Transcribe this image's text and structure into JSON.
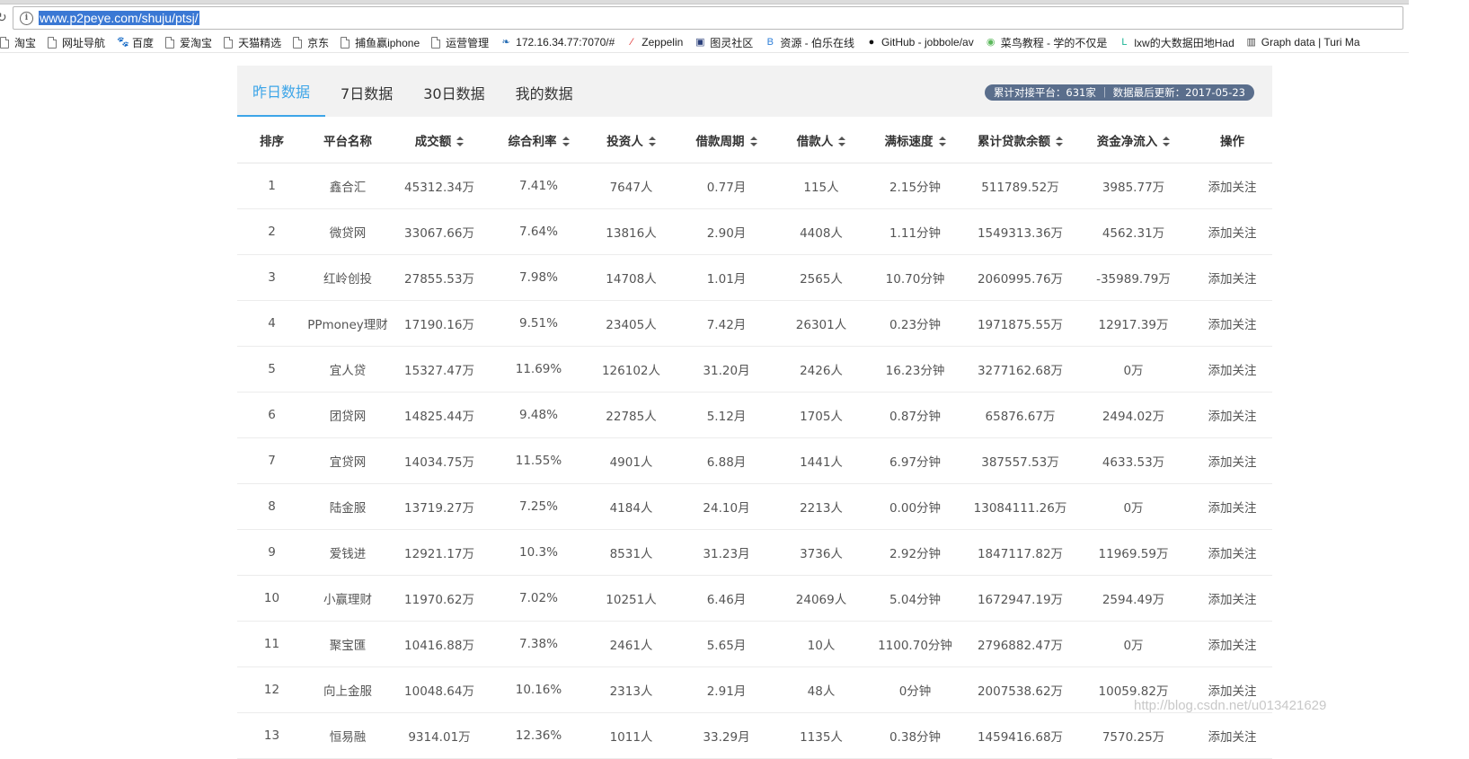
{
  "browser": {
    "url": "www.p2peye.com/shuju/ptsj/",
    "bookmarks": [
      {
        "label": "淘宝",
        "icon": "page-icon"
      },
      {
        "label": "网址导航",
        "icon": "page-icon"
      },
      {
        "label": "百度",
        "icon": "baidu-paw-icon"
      },
      {
        "label": "爱淘宝",
        "icon": "page-icon"
      },
      {
        "label": "天猫精选",
        "icon": "page-icon"
      },
      {
        "label": "京东",
        "icon": "page-icon"
      },
      {
        "label": "捕鱼赢iphone",
        "icon": "page-icon"
      },
      {
        "label": "运营管理",
        "icon": "page-icon"
      },
      {
        "label": "172.16.34.77:7070/#",
        "icon": "leaf-icon"
      },
      {
        "label": "Zeppelin",
        "icon": "zeppelin-icon"
      },
      {
        "label": "图灵社区",
        "icon": "turing-icon"
      },
      {
        "label": "资源 - 伯乐在线",
        "icon": "bole-icon"
      },
      {
        "label": "GitHub - jobbole/av",
        "icon": "github-icon"
      },
      {
        "label": "菜鸟教程 - 学的不仅是",
        "icon": "runoob-icon"
      },
      {
        "label": "lxw的大数据田地Had",
        "icon": "lxw-icon"
      },
      {
        "label": "Graph data | Turi Ma",
        "icon": "book-icon"
      }
    ]
  },
  "tabs": [
    "昨日数据",
    "7日数据",
    "30日数据",
    "我的数据"
  ],
  "stats": "累计对接平台：631家 ｜ 数据最后更新：2017-05-23",
  "columns": [
    "排序",
    "平台名称",
    "成交额",
    "综合利率",
    "投资人",
    "借款周期",
    "借款人",
    "满标速度",
    "累计贷款余额",
    "资金净流入",
    "操作"
  ],
  "rows": [
    [
      "1",
      "鑫合汇",
      "45312.34万",
      "7.41%",
      "7647人",
      "0.77月",
      "115人",
      "2.15分钟",
      "511789.52万",
      "3985.77万",
      "添加关注"
    ],
    [
      "2",
      "微贷网",
      "33067.66万",
      "7.64%",
      "13816人",
      "2.90月",
      "4408人",
      "1.11分钟",
      "1549313.36万",
      "4562.31万",
      "添加关注"
    ],
    [
      "3",
      "红岭创投",
      "27855.53万",
      "7.98%",
      "14708人",
      "1.01月",
      "2565人",
      "10.70分钟",
      "2060995.76万",
      "-35989.79万",
      "添加关注"
    ],
    [
      "4",
      "PPmoney理财",
      "17190.16万",
      "9.51%",
      "23405人",
      "7.42月",
      "26301人",
      "0.23分钟",
      "1971875.55万",
      "12917.39万",
      "添加关注"
    ],
    [
      "5",
      "宜人贷",
      "15327.47万",
      "11.69%",
      "126102人",
      "31.20月",
      "2426人",
      "16.23分钟",
      "3277162.68万",
      "0万",
      "添加关注"
    ],
    [
      "6",
      "团贷网",
      "14825.44万",
      "9.48%",
      "22785人",
      "5.12月",
      "1705人",
      "0.87分钟",
      "65876.67万",
      "2494.02万",
      "添加关注"
    ],
    [
      "7",
      "宜贷网",
      "14034.75万",
      "11.55%",
      "4901人",
      "6.88月",
      "1441人",
      "6.97分钟",
      "387557.53万",
      "4633.53万",
      "添加关注"
    ],
    [
      "8",
      "陆金服",
      "13719.27万",
      "7.25%",
      "4184人",
      "24.10月",
      "2213人",
      "0.00分钟",
      "13084111.26万",
      "0万",
      "添加关注"
    ],
    [
      "9",
      "爱钱进",
      "12921.17万",
      "10.3%",
      "8531人",
      "31.23月",
      "3736人",
      "2.92分钟",
      "1847117.82万",
      "11969.59万",
      "添加关注"
    ],
    [
      "10",
      "小赢理财",
      "11970.62万",
      "7.02%",
      "10251人",
      "6.46月",
      "24069人",
      "5.04分钟",
      "1672947.19万",
      "2594.49万",
      "添加关注"
    ],
    [
      "11",
      "聚宝匯",
      "10416.88万",
      "7.38%",
      "2461人",
      "5.65月",
      "10人",
      "1100.70分钟",
      "2796882.47万",
      "0万",
      "添加关注"
    ],
    [
      "12",
      "向上金服",
      "10048.64万",
      "10.16%",
      "2313人",
      "2.91月",
      "48人",
      "0分钟",
      "2007538.62万",
      "10059.82万",
      "添加关注"
    ],
    [
      "13",
      "恒易融",
      "9314.01万",
      "12.36%",
      "1011人",
      "33.29月",
      "1135人",
      "0.38分钟",
      "1459416.68万",
      "7570.25万",
      "添加关注"
    ]
  ],
  "watermark": "http://blog.csdn.net/u013421629",
  "colors": {
    "accent": "#3da5e8",
    "pill": "#5a6e8c"
  }
}
